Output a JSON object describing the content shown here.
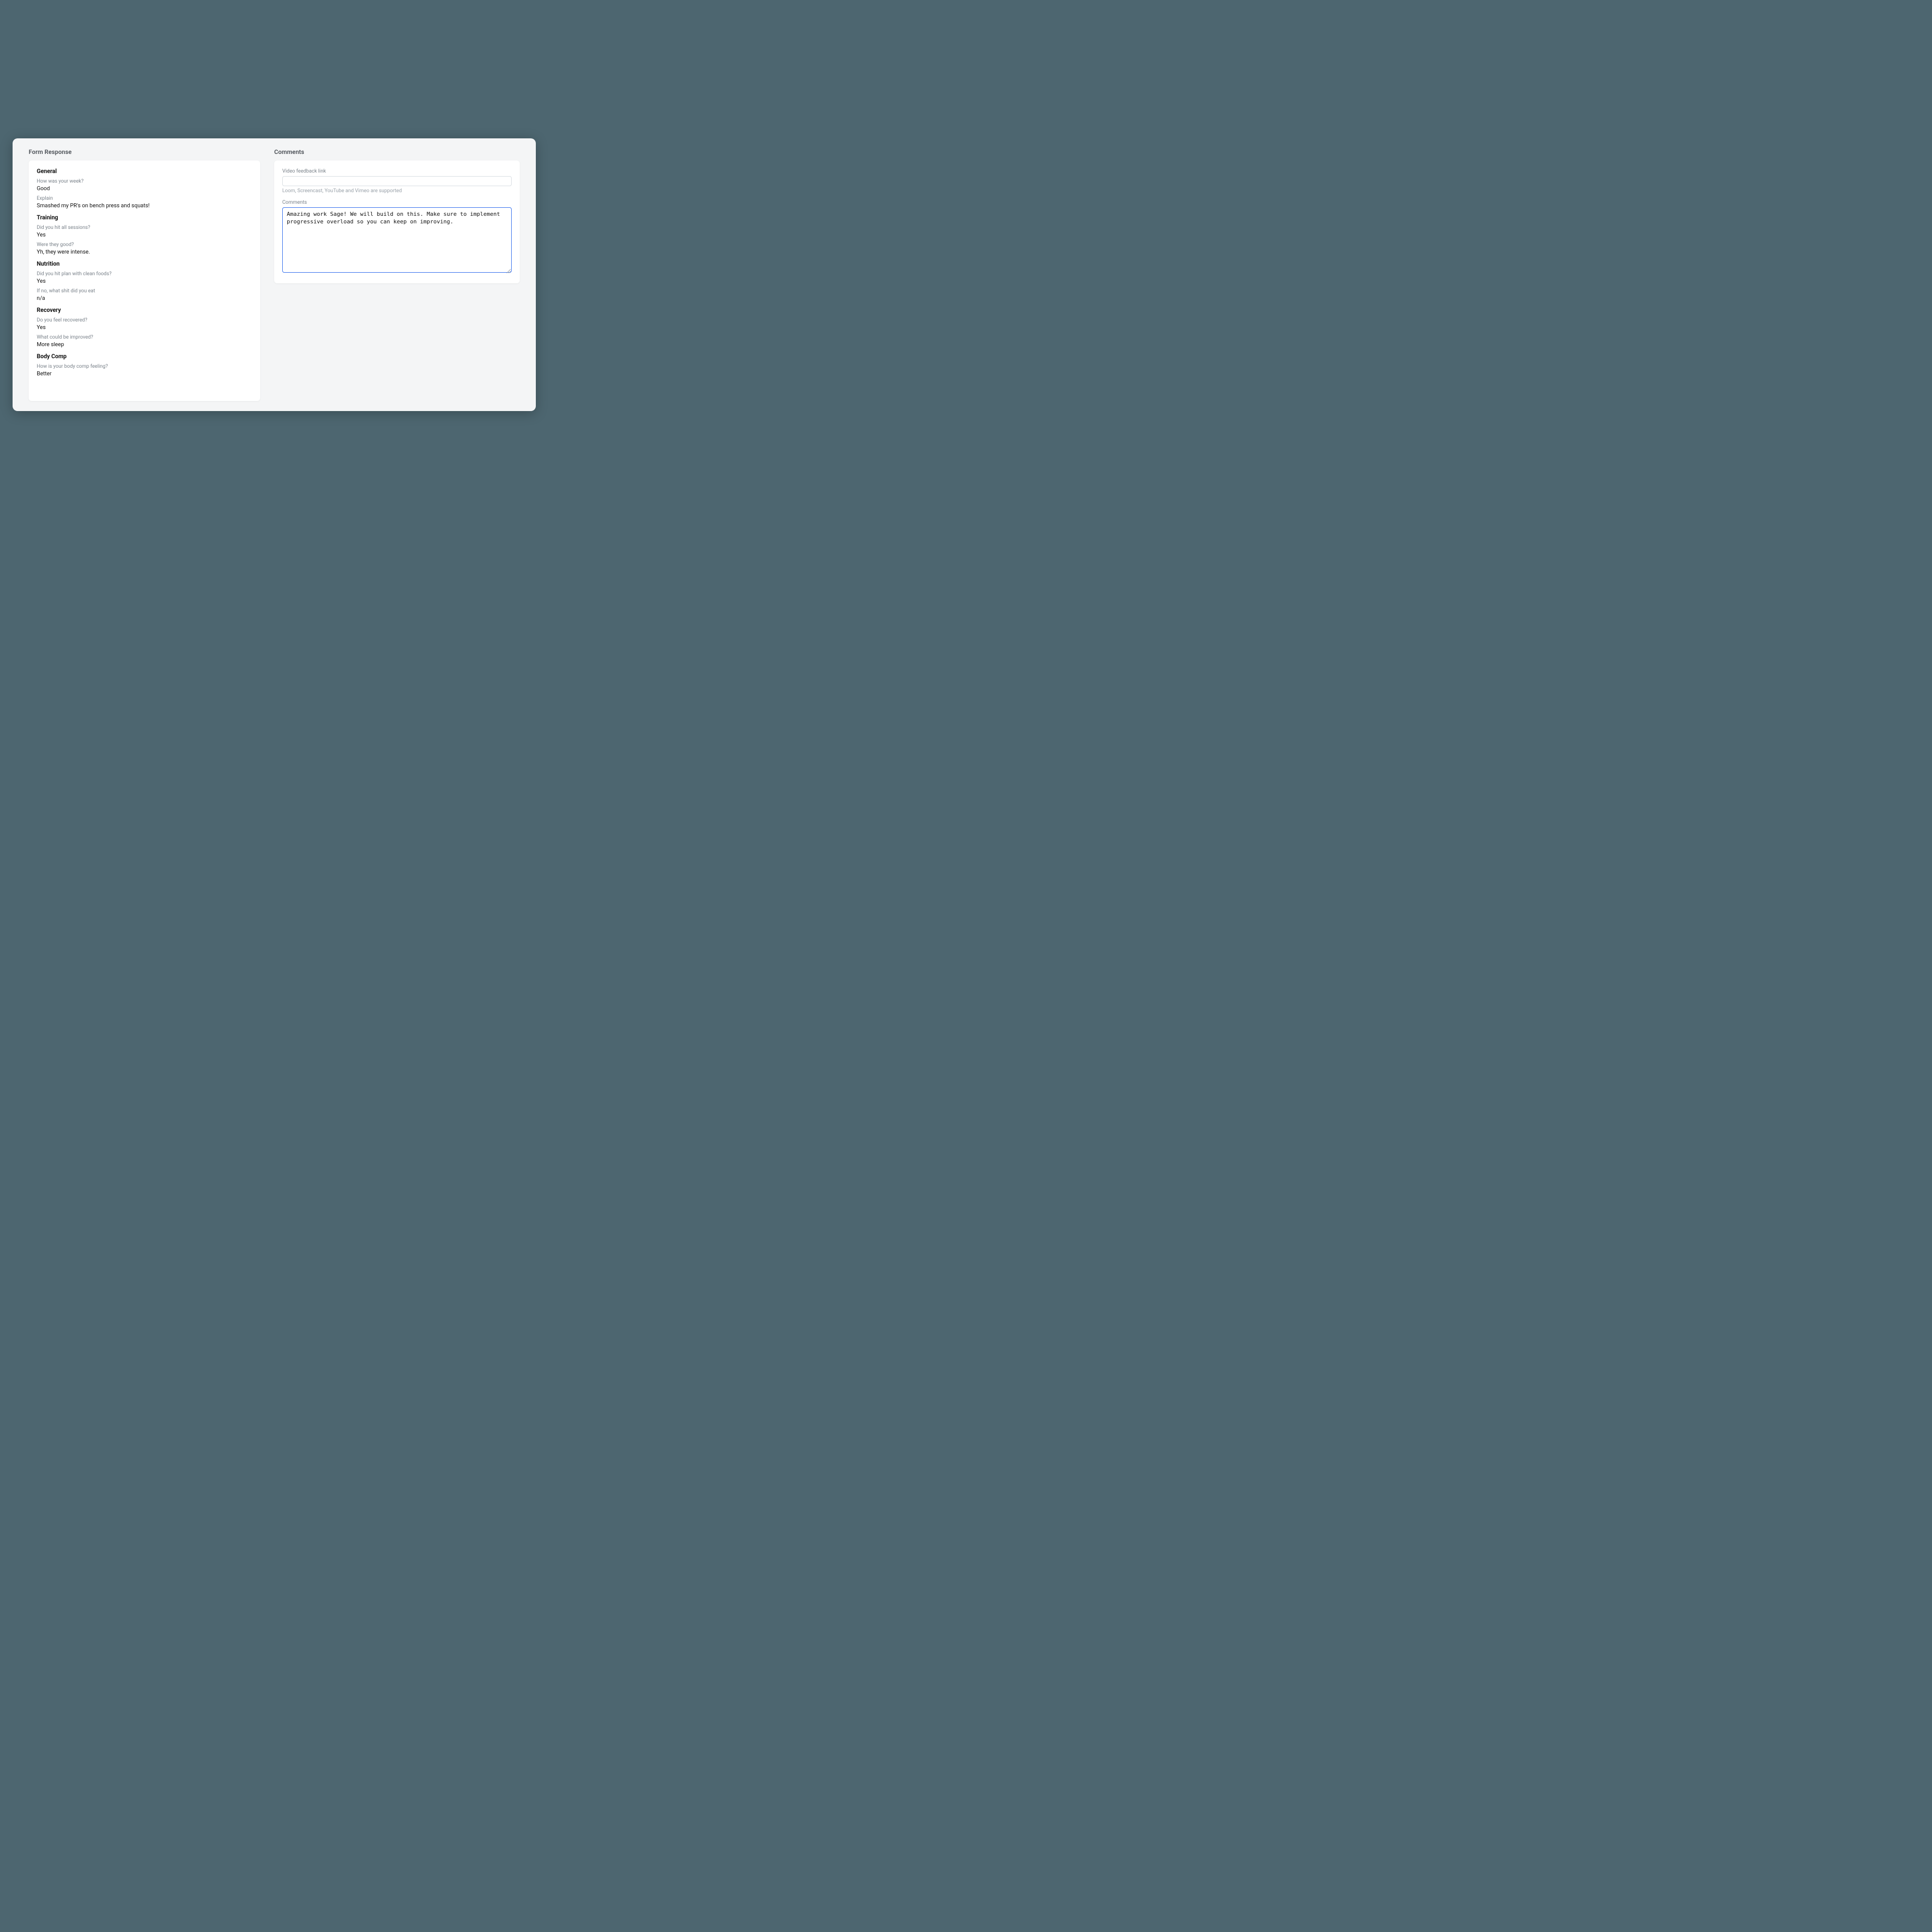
{
  "left": {
    "title": "Form Response",
    "sections": [
      {
        "title": "General",
        "items": [
          {
            "q": "How was your week?",
            "a": "Good"
          },
          {
            "q": "Explain",
            "a": "Smashed my PR's on bench press and squats!"
          }
        ]
      },
      {
        "title": "Training",
        "items": [
          {
            "q": "Did you hit all sessions?",
            "a": "Yes"
          },
          {
            "q": "Were they good?",
            "a": "Yh, they were intense."
          }
        ]
      },
      {
        "title": "Nutrition",
        "items": [
          {
            "q": "Did you hit plan with clean foods?",
            "a": "Yes"
          },
          {
            "q": "If no, what shit did you eat",
            "a": "n/a"
          }
        ]
      },
      {
        "title": "Recovery",
        "items": [
          {
            "q": "Do you feel recovered?",
            "a": "Yes"
          },
          {
            "q": "What could be improved?",
            "a": "More sleep"
          }
        ]
      },
      {
        "title": "Body Comp",
        "items": [
          {
            "q": "How is your body comp feeling?",
            "a": "Better"
          }
        ]
      }
    ]
  },
  "right": {
    "title": "Comments",
    "videoLabel": "Video feedback link",
    "videoValue": "",
    "videoHelper": "Loom, Screencast, YouTube and Vimeo are supported",
    "commentsLabel": "Comments",
    "commentsValue": "Amazing work Sage! We will build on this. Make sure to implement progressive overload so you can keep on improving."
  }
}
